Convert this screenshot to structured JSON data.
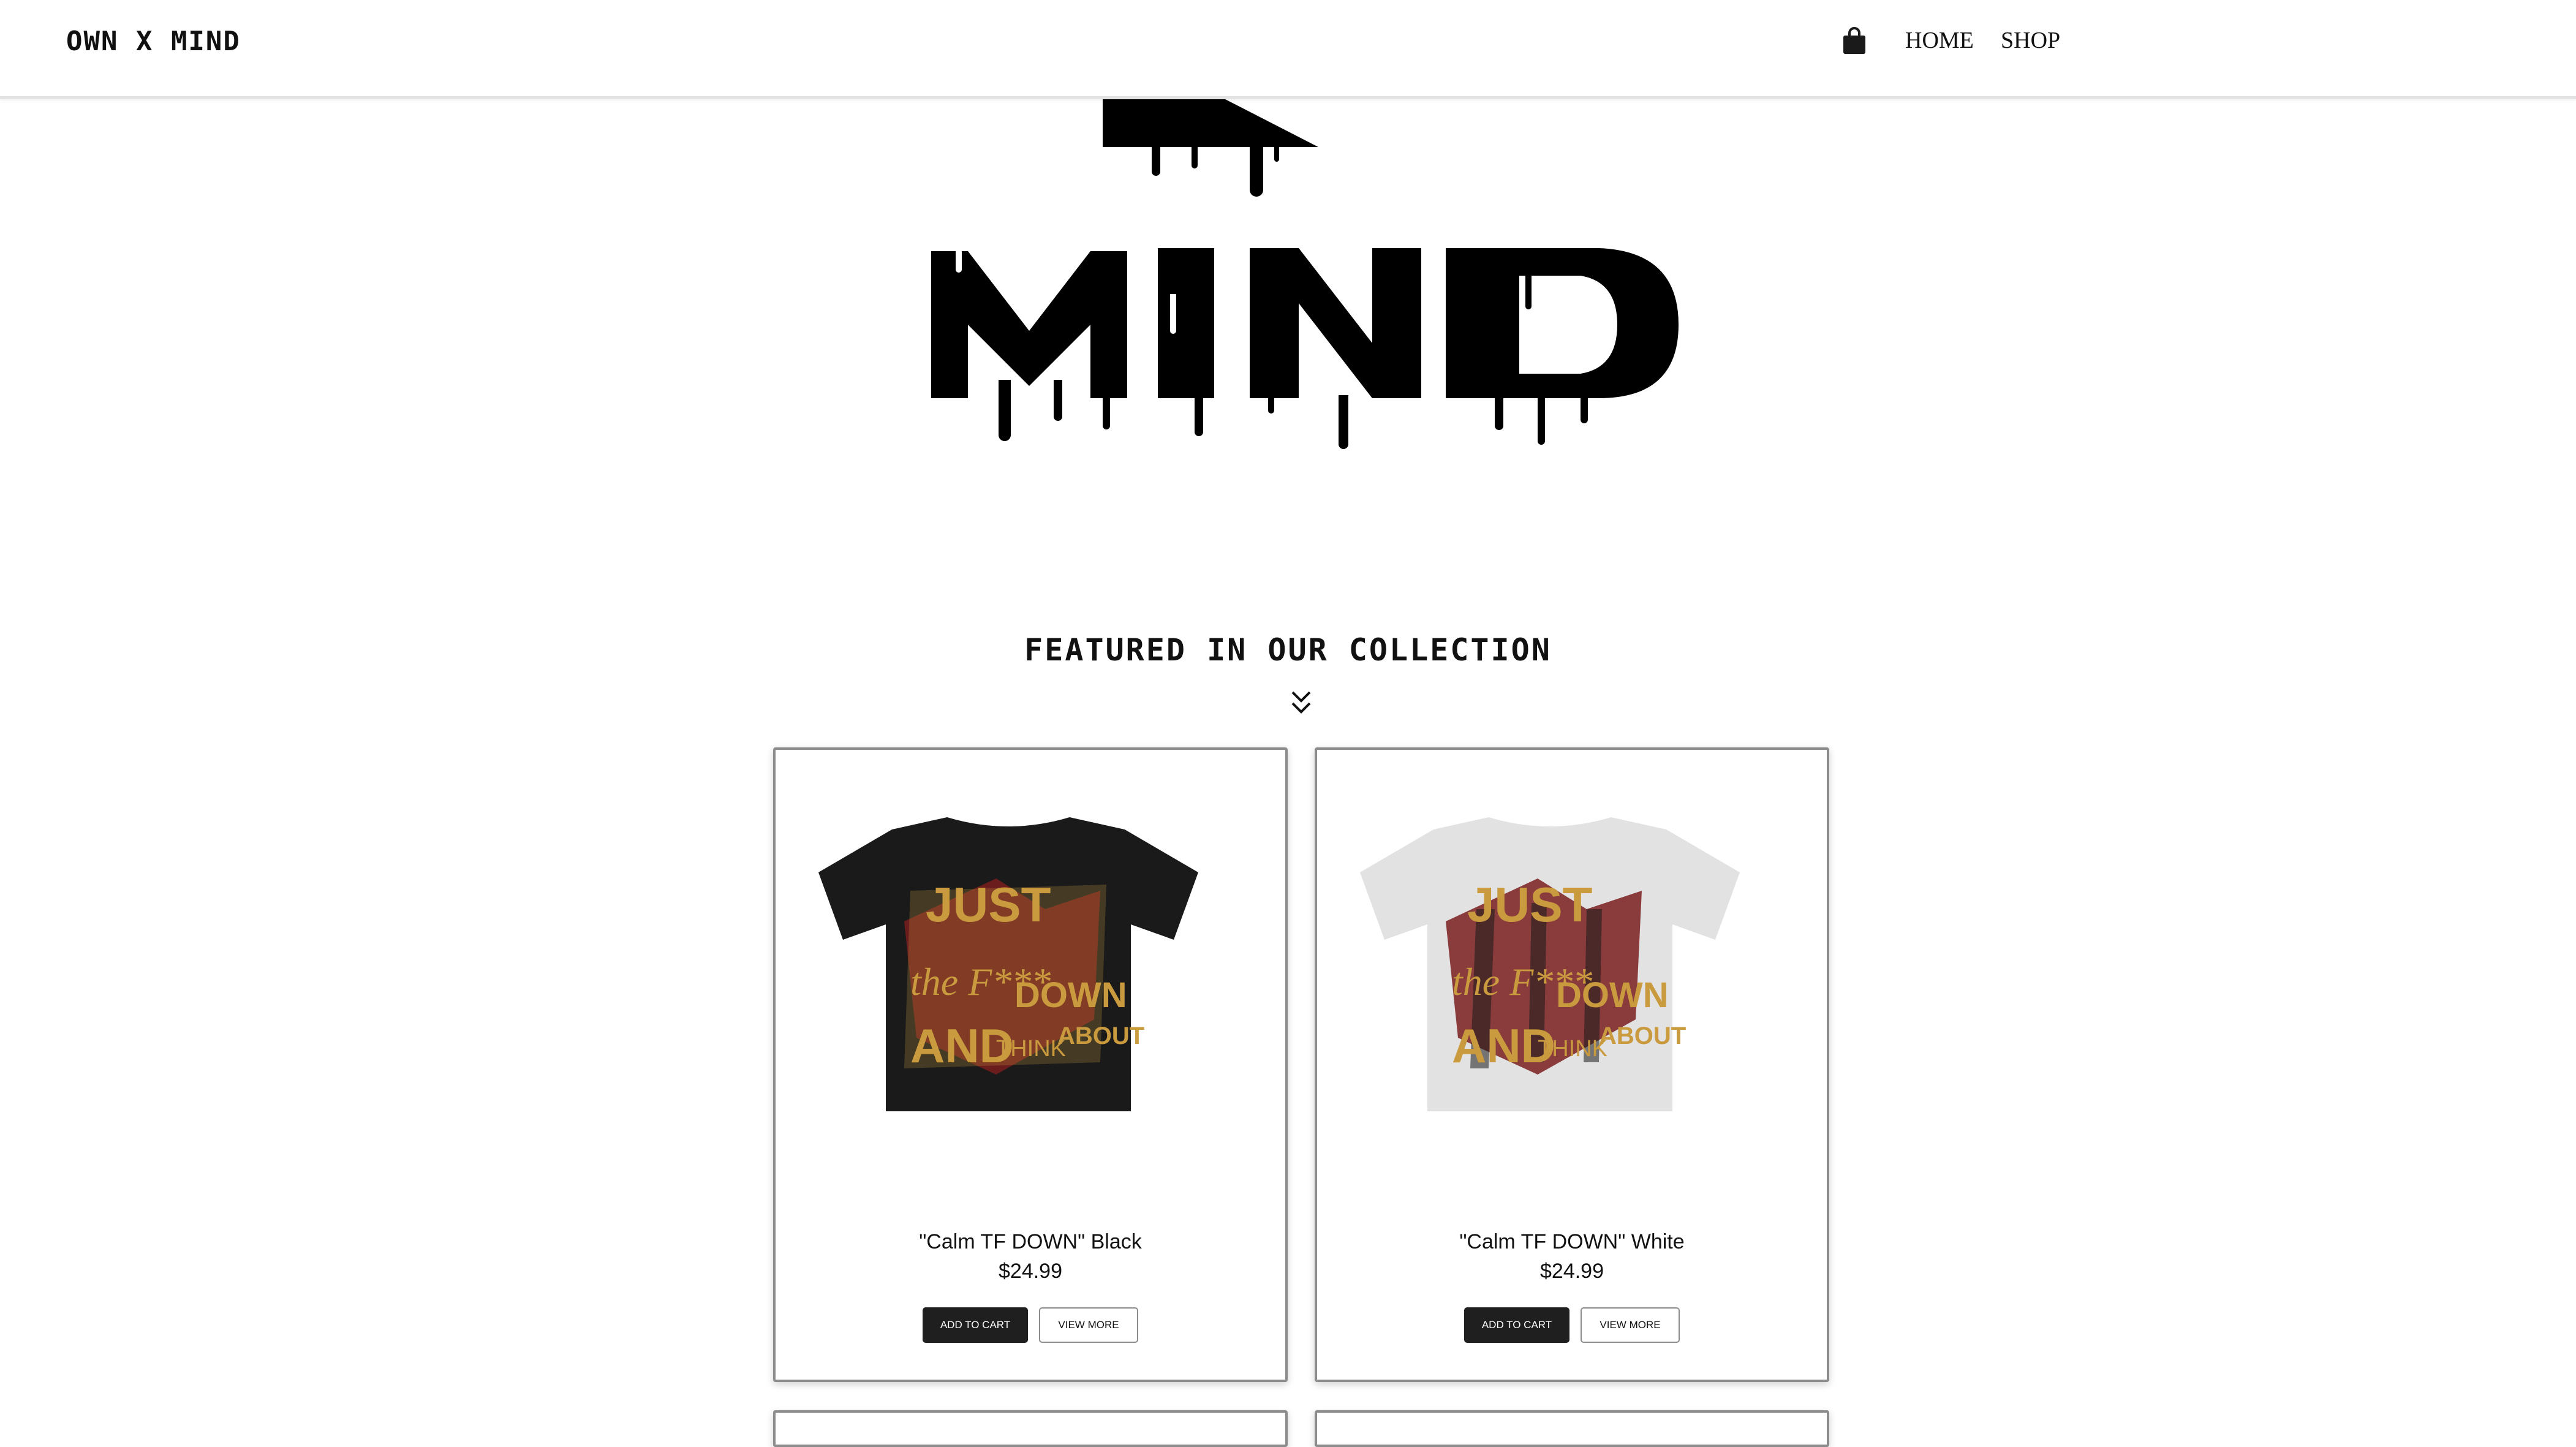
{
  "header": {
    "logo": "OWN X MIND",
    "nav": [
      {
        "label": "HOME"
      },
      {
        "label": "SHOP"
      }
    ]
  },
  "hero": {
    "logo_word": "MIND"
  },
  "featured": {
    "title": "FEATURED IN OUR COLLECTION"
  },
  "products": [
    {
      "name": "\"Calm TF DOWN\" Black",
      "price": "$24.99",
      "add_to_cart": "ADD TO CART",
      "view_more": "VIEW MORE",
      "shirt_color": "#1a1a1a"
    },
    {
      "name": "\"Calm TF DOWN\" White",
      "price": "$24.99",
      "add_to_cart": "ADD TO CART",
      "view_more": "VIEW MORE",
      "shirt_color": "#e2e2e2"
    }
  ],
  "colors": {
    "accent_gold": "#c99a3e",
    "accent_red": "#7a1e1e",
    "button_dark": "#1f1f1f"
  },
  "icons": {
    "cart": "shopping-bag-icon",
    "scroll": "double-chevron-down-icon"
  }
}
